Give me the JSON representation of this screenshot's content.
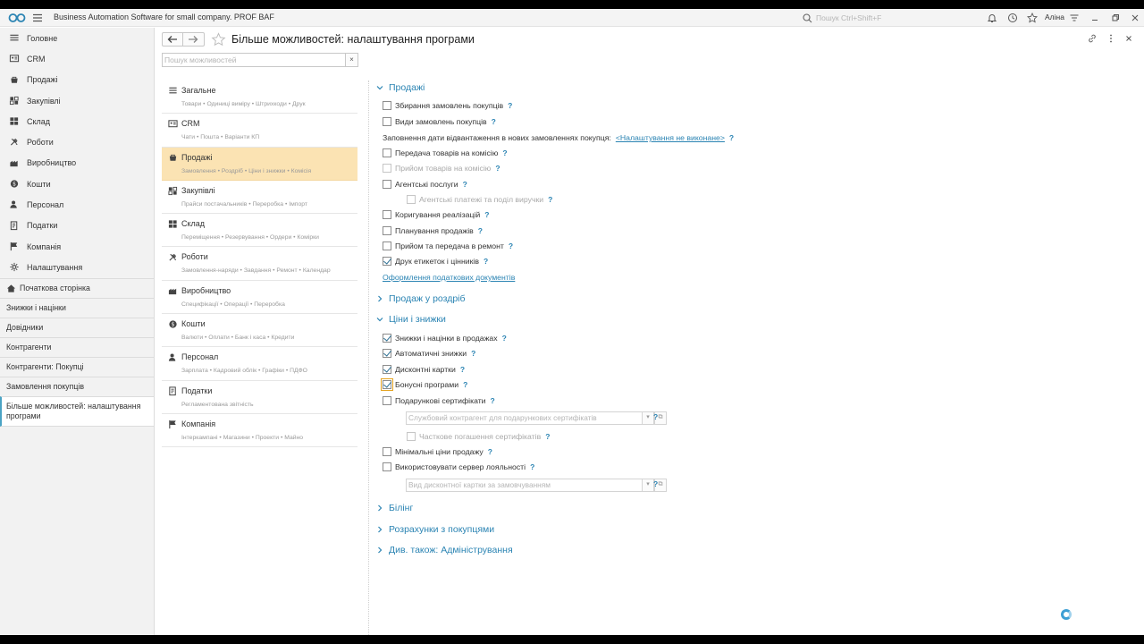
{
  "app": {
    "title": "Business Automation Software for small company. PROF BAF",
    "search_placeholder": "Пошук Ctrl+Shift+F",
    "user": "Аліна"
  },
  "sidebar": {
    "sections": [
      {
        "label": "Головне",
        "icon": "menu-lines-icon"
      },
      {
        "label": "CRM",
        "icon": "crm-icon"
      },
      {
        "label": "Продажі",
        "icon": "sales-icon"
      },
      {
        "label": "Закупівлі",
        "icon": "purchases-icon"
      },
      {
        "label": "Склад",
        "icon": "warehouse-icon"
      },
      {
        "label": "Роботи",
        "icon": "works-icon"
      },
      {
        "label": "Виробництво",
        "icon": "production-icon"
      },
      {
        "label": "Кошти",
        "icon": "money-icon"
      },
      {
        "label": "Персонал",
        "icon": "person-icon"
      },
      {
        "label": "Податки",
        "icon": "taxes-icon"
      },
      {
        "label": "Компанія",
        "icon": "flag-icon"
      },
      {
        "label": "Налаштування",
        "icon": "gear-icon"
      }
    ],
    "open_windows": [
      {
        "label": "Початкова сторінка"
      },
      {
        "label": "Знижки і націнки"
      },
      {
        "label": "Довідники"
      },
      {
        "label": "Контрагенти"
      },
      {
        "label": "Контрагенти: Покупці"
      },
      {
        "label": "Замовлення покупців"
      },
      {
        "label": "Більше можливостей: налаштування програми"
      }
    ]
  },
  "header": {
    "title": "Більше можливостей: налаштування програми"
  },
  "features_search": {
    "placeholder": "Пошук можливостей",
    "clear": "×"
  },
  "sections": [
    {
      "title": "Загальне",
      "sub": "Товари • Одиниці виміру • Штрихкоди • Друк",
      "icon": "list-icon"
    },
    {
      "title": "CRM",
      "sub": "Чати • Пошта • Варіанти КП",
      "icon": "crm-icon"
    },
    {
      "title": "Продажі",
      "sub": "Замовлення • Роздріб • Ціни і знижки • Комісія",
      "icon": "sales-icon",
      "active": true
    },
    {
      "title": "Закупівлі",
      "sub": "Прайси постачальників • Переробка • Імпорт",
      "icon": "purchases-icon"
    },
    {
      "title": "Склад",
      "sub": "Переміщення • Резервування • Ордери • Комірки",
      "icon": "warehouse-icon"
    },
    {
      "title": "Роботи",
      "sub": "Замовлення-наряди • Завдання • Ремонт • Календар",
      "icon": "works-icon"
    },
    {
      "title": "Виробництво",
      "sub": "Специфікації • Операції • Переробка",
      "icon": "production-icon"
    },
    {
      "title": "Кошти",
      "sub": "Валюти • Оплати • Банк і каса • Кредити",
      "icon": "money-icon"
    },
    {
      "title": "Персонал",
      "sub": "Зарплата • Кадровий облік • Графіки • ПДФО",
      "icon": "person-icon"
    },
    {
      "title": "Податки",
      "sub": "Регламентована звітність",
      "icon": "taxes-icon"
    },
    {
      "title": "Компанія",
      "sub": "Інтеркампані • Магазини • Проекти • Майно",
      "icon": "flag-icon"
    }
  ],
  "panel": {
    "sales_group": "Продажі",
    "order_collection": "Збирання замовлень покупців",
    "order_types": "Види замовлень покупців",
    "shipment_date_label": "Заповнення дати відвантаження в нових замовленнях покупця:",
    "shipment_date_link": "<Налаштування не виконане>",
    "consignment_out": "Передача товарів на комісію",
    "consignment_in": "Прийом товарів на комісію",
    "agent_services": "Агентські послуги",
    "agent_payments": "Агентські платежі та поділ виручки",
    "sales_correction": "Коригування реалізацій",
    "sales_planning": "Планування продажів",
    "repair": "Прийом та передача в ремонт",
    "labels_printing": "Друк етикеток і цінників",
    "tax_docs_link": "Оформлення податкових документів",
    "retail_group": "Продаж у роздріб",
    "prices_group": "Ціни і знижки",
    "discounts_markups": "Знижки і націнки в продажах",
    "auto_discounts": "Автоматичні знижки",
    "discount_cards": "Дисконтні картки",
    "bonus_programs": "Бонусні програми",
    "gift_certificates": "Подарункові сертифікати",
    "gift_cert_counterparty_placeholder": "Службовий контрагент для подарункових сертифікатів",
    "partial_repayment": "Часткове погашення сертифікатів",
    "min_prices": "Мінімальні ціни продажу",
    "loyalty_server": "Використовувати сервер лояльності",
    "default_card_type_placeholder": "Вид дисконтної картки за замовчуванням",
    "billing_group": "Білінг",
    "settlements_group": "Розрахунки з покупцями",
    "see_also_group": "Див. також: Адміністрування",
    "q": "?"
  },
  "colors": {
    "accent": "#2b84b3",
    "active_section": "#fbe3b3"
  }
}
